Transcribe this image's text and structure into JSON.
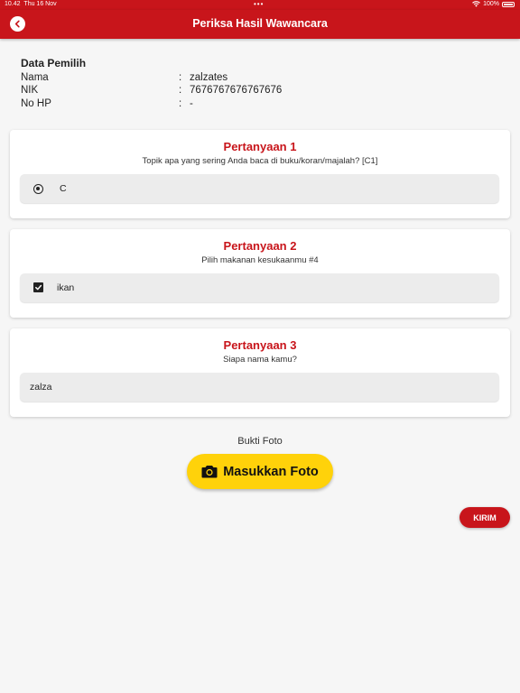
{
  "status_bar": {
    "time": "10.42",
    "date": "Thu 16 Nov",
    "battery": "100%",
    "dots": "•••"
  },
  "app_bar": {
    "title": "Periksa Hasil Wawancara"
  },
  "voter": {
    "heading": "Data Pemilih",
    "fields": [
      {
        "label": "Nama",
        "value": "zalzates"
      },
      {
        "label": "NIK",
        "value": "7676767676767676"
      },
      {
        "label": "No HP",
        "value": "-"
      }
    ],
    "separator": ":"
  },
  "questions": [
    {
      "title": "Pertanyaan 1",
      "text": "Topik apa yang sering Anda baca di buku/koran/majalah? [C1]",
      "answer_type": "radio",
      "answer": "C"
    },
    {
      "title": "Pertanyaan 2",
      "text": "Pilih makanan kesukaanmu #4",
      "answer_type": "checkbox",
      "answer": "ikan"
    },
    {
      "title": "Pertanyaan 3",
      "text": "Siapa nama kamu?",
      "answer_type": "text",
      "answer": "zalza"
    }
  ],
  "photo": {
    "caption": "Bukti Foto",
    "button_label": "Masukkan Foto",
    "icon": "camera-icon"
  },
  "submit": {
    "label": "KIRIM"
  },
  "colors": {
    "primary": "#c8151b",
    "accent": "#ffd20a",
    "background": "#f6f6f6"
  }
}
